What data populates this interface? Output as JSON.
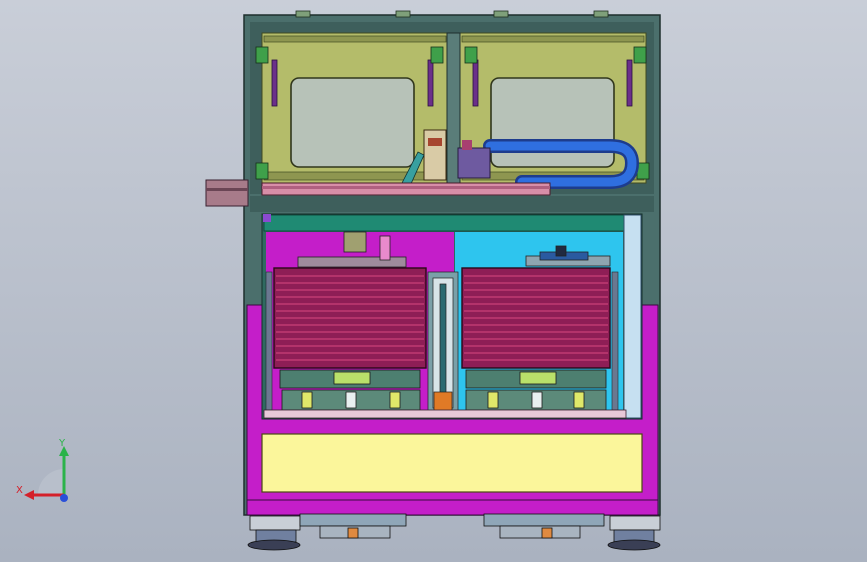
{
  "viewport": {
    "background_top": "#c9ced8",
    "background_bottom": "#aab2c0"
  },
  "colors": {
    "frame": "#4b6f6c",
    "frame_dark": "#2f4a48",
    "upper_panel": "#b4bc6a",
    "upper_panel_dark": "#8e9650",
    "window_bg": "#b7c2b8",
    "magenta": "#c41ec9",
    "cyan": "#2ec5ee",
    "pale_blue": "#c6e0f1",
    "transformer": "#8e1e56",
    "transformer_line": "#d84880",
    "cable": "#2757c6",
    "yellow_panel": "#fbf69b",
    "teal_bar": "#1f8a73",
    "orange_part": "#e07a26",
    "green_part": "#b9e06a"
  },
  "triad": {
    "x_label": "X",
    "y_label": "Y",
    "x_color": "#d4202a",
    "y_color": "#2bb34a",
    "z_color": "#2a4fd8"
  }
}
